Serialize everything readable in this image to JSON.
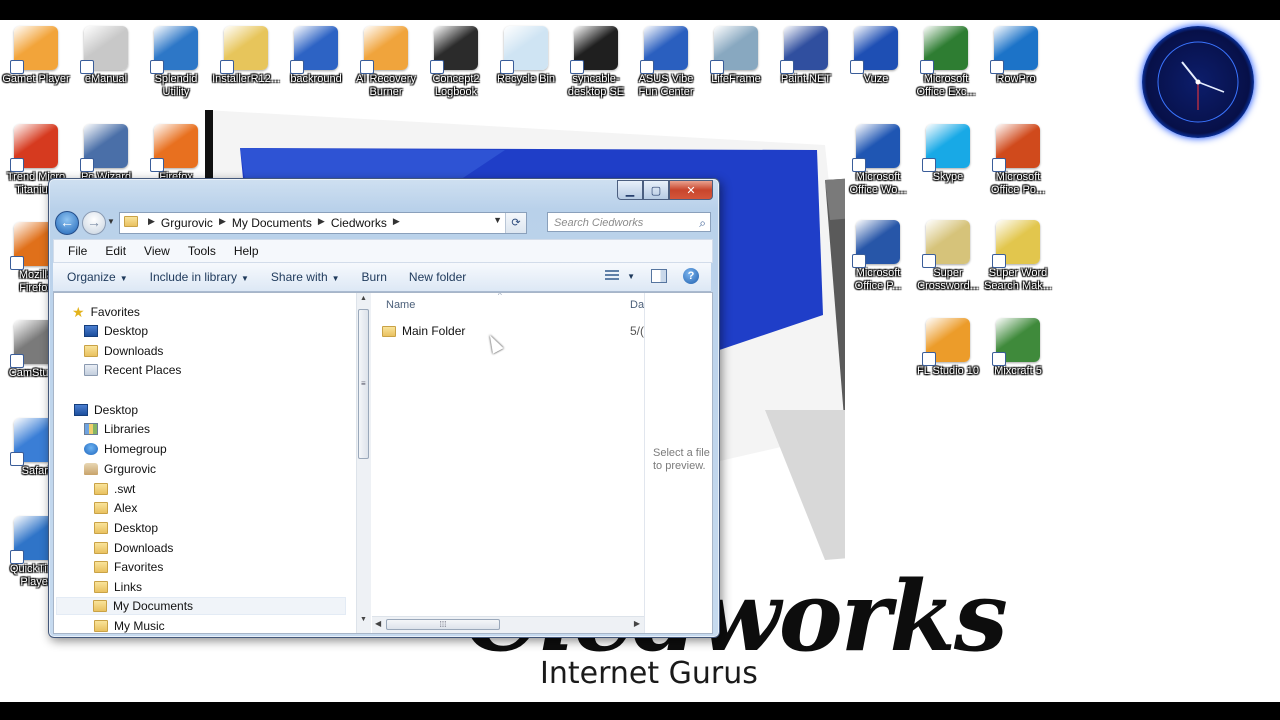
{
  "desktop": {
    "brand": {
      "script": "Ciedworks",
      "tagline": "Internet Gurus"
    },
    "icons_row1": [
      {
        "label": "Gamet Player",
        "color": "#f2a43a"
      },
      {
        "label": "eManual",
        "color": "#c8c8c8"
      },
      {
        "label": "Splendid\nUtility",
        "color": "#2d77c7"
      },
      {
        "label": "InstallerR12...",
        "color": "#e7c55b"
      },
      {
        "label": "backround",
        "color": "#2d63c4"
      },
      {
        "label": "AI Recovery\nBurner",
        "color": "#f0a43c"
      },
      {
        "label": "Concept2\nLogbook",
        "color": "#2b2b2b"
      },
      {
        "label": "Recycle Bin",
        "color": "#cfe4f3"
      },
      {
        "label": "syncable-\ndesktop SE",
        "color": "#1f1f1f"
      },
      {
        "label": "ASUS  Vibe\nFun Center",
        "color": "#2a5fbf"
      },
      {
        "label": "LifeFrame",
        "color": "#88a8c0"
      },
      {
        "label": "Paint.NET",
        "color": "#304f9f"
      },
      {
        "label": "Vuze",
        "color": "#1e4fb4"
      },
      {
        "label": "Microsoft\nOffice Exc...",
        "color": "#2e7d32"
      },
      {
        "label": "RowPro",
        "color": "#1c73c8"
      }
    ],
    "icons_left": [
      {
        "label": "Trend Micro\nTitanium",
        "color": "#d63a1f"
      },
      {
        "label": "Pc Wizard",
        "color": "#4a6fa8"
      },
      {
        "label": "Firefox",
        "color": "#e8701f"
      },
      {
        "label": "Mozilla\nFirefox",
        "color": "#e0701a"
      },
      {
        "label": "CamStudio",
        "color": "#7a7a7a"
      },
      {
        "label": "Safari",
        "color": "#3a7ed6"
      },
      {
        "label": "QuickTime\nPlayer",
        "color": "#2f74c8"
      }
    ],
    "icons_right": [
      {
        "label": "Microsoft\nOffice Wo...",
        "color": "#1f56b3"
      },
      {
        "label": "Skype",
        "color": "#18a9e6"
      },
      {
        "label": "Microsoft\nOffice Po...",
        "color": "#d04a1c"
      },
      {
        "label": "Microsoft\nOffice P...",
        "color": "#2756a8"
      },
      {
        "label": "Super\nCrossword...",
        "color": "#d6c37a"
      },
      {
        "label": "Super Word\nSearch Mak...",
        "color": "#e2c64d"
      },
      {
        "label": "FL Studio 10",
        "color": "#ec9c2a"
      },
      {
        "label": "Mixcraft 5",
        "color": "#3f8a3b"
      }
    ]
  },
  "explorer": {
    "address": {
      "crumbs": [
        "Grgurovic",
        "My Documents",
        "Ciedworks"
      ]
    },
    "search": {
      "placeholder": "Search Ciedworks"
    },
    "menu": [
      "File",
      "Edit",
      "View",
      "Tools",
      "Help"
    ],
    "commands": {
      "organize": "Organize",
      "include": "Include in library",
      "share": "Share with",
      "burn": "Burn",
      "newfolder": "New folder"
    },
    "nav": {
      "favorites_header": "Favorites",
      "favorites": [
        "Desktop",
        "Downloads",
        "Recent Places"
      ],
      "desktop": "Desktop",
      "libraries": "Libraries",
      "homegroup": "Homegroup",
      "user": "Grgurovic",
      "user_folders": [
        ".swt",
        "Alex",
        "Desktop",
        "Downloads",
        "Favorites",
        "Links",
        "My Documents",
        "My Music"
      ]
    },
    "columns": {
      "name": "Name",
      "date": "Da"
    },
    "files": [
      {
        "name": "Main Folder",
        "date": "5/("
      }
    ],
    "preview_text": "Select a file to preview."
  }
}
